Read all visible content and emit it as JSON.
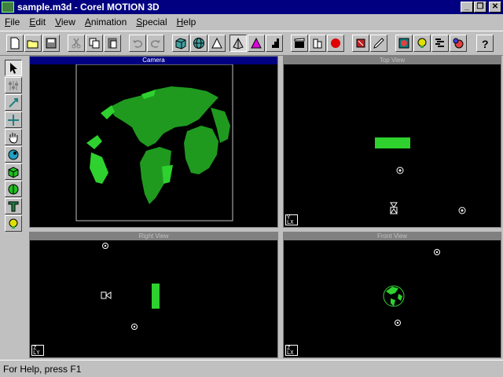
{
  "window": {
    "title": "sample.m3d - Corel MOTION 3D"
  },
  "menu": [
    {
      "u": "F",
      "rest": "ile"
    },
    {
      "u": "E",
      "rest": "dit"
    },
    {
      "u": "V",
      "rest": "iew"
    },
    {
      "u": "A",
      "rest": "nimation"
    },
    {
      "u": "S",
      "rest": "pecial"
    },
    {
      "u": "H",
      "rest": "elp"
    }
  ],
  "viewports": {
    "camera": {
      "title": "Camera"
    },
    "top": {
      "title": "Top View",
      "axis_top": "Y",
      "axis_bottom": "LX"
    },
    "right": {
      "title": "Right View",
      "axis_top": "Z",
      "axis_bottom": "LY"
    },
    "front": {
      "title": "Front View",
      "axis_top": "Z",
      "axis_bottom": "LX"
    }
  },
  "status": {
    "text": "For Help, press F1"
  },
  "colors": {
    "title_active": "#000080",
    "globe_green": "#1f9a1f",
    "bright_green": "#2ed12e"
  }
}
